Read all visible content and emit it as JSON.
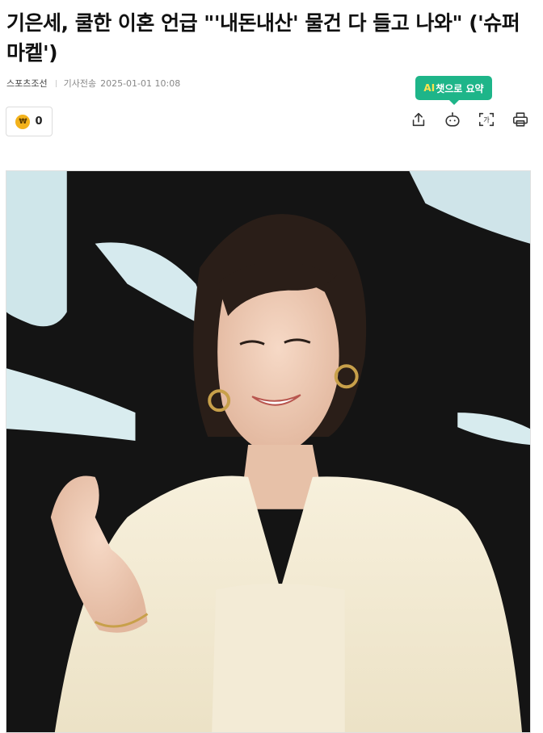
{
  "article": {
    "headline": "기은세, 쿨한 이혼 언급 \"'내돈내산' 물건 다 들고 나와\" ('슈퍼마켙')",
    "press": "스포츠조선",
    "date_label": "기사전송",
    "date": "2025-01-01 10:08"
  },
  "ai_summary": {
    "ai": "AI",
    "label": "챗으로 요약"
  },
  "reaction": {
    "coin_symbol": "₩",
    "count": "0"
  },
  "toolbar": {
    "icons": [
      "share-icon",
      "ai-chat-bot-icon",
      "text-size-icon",
      "print-icon"
    ],
    "text_size_glyph": "가"
  },
  "colors": {
    "ai_badge_bg": "#1eb589",
    "ai_text": "#ffe34d",
    "coin": "#f3b21b"
  }
}
